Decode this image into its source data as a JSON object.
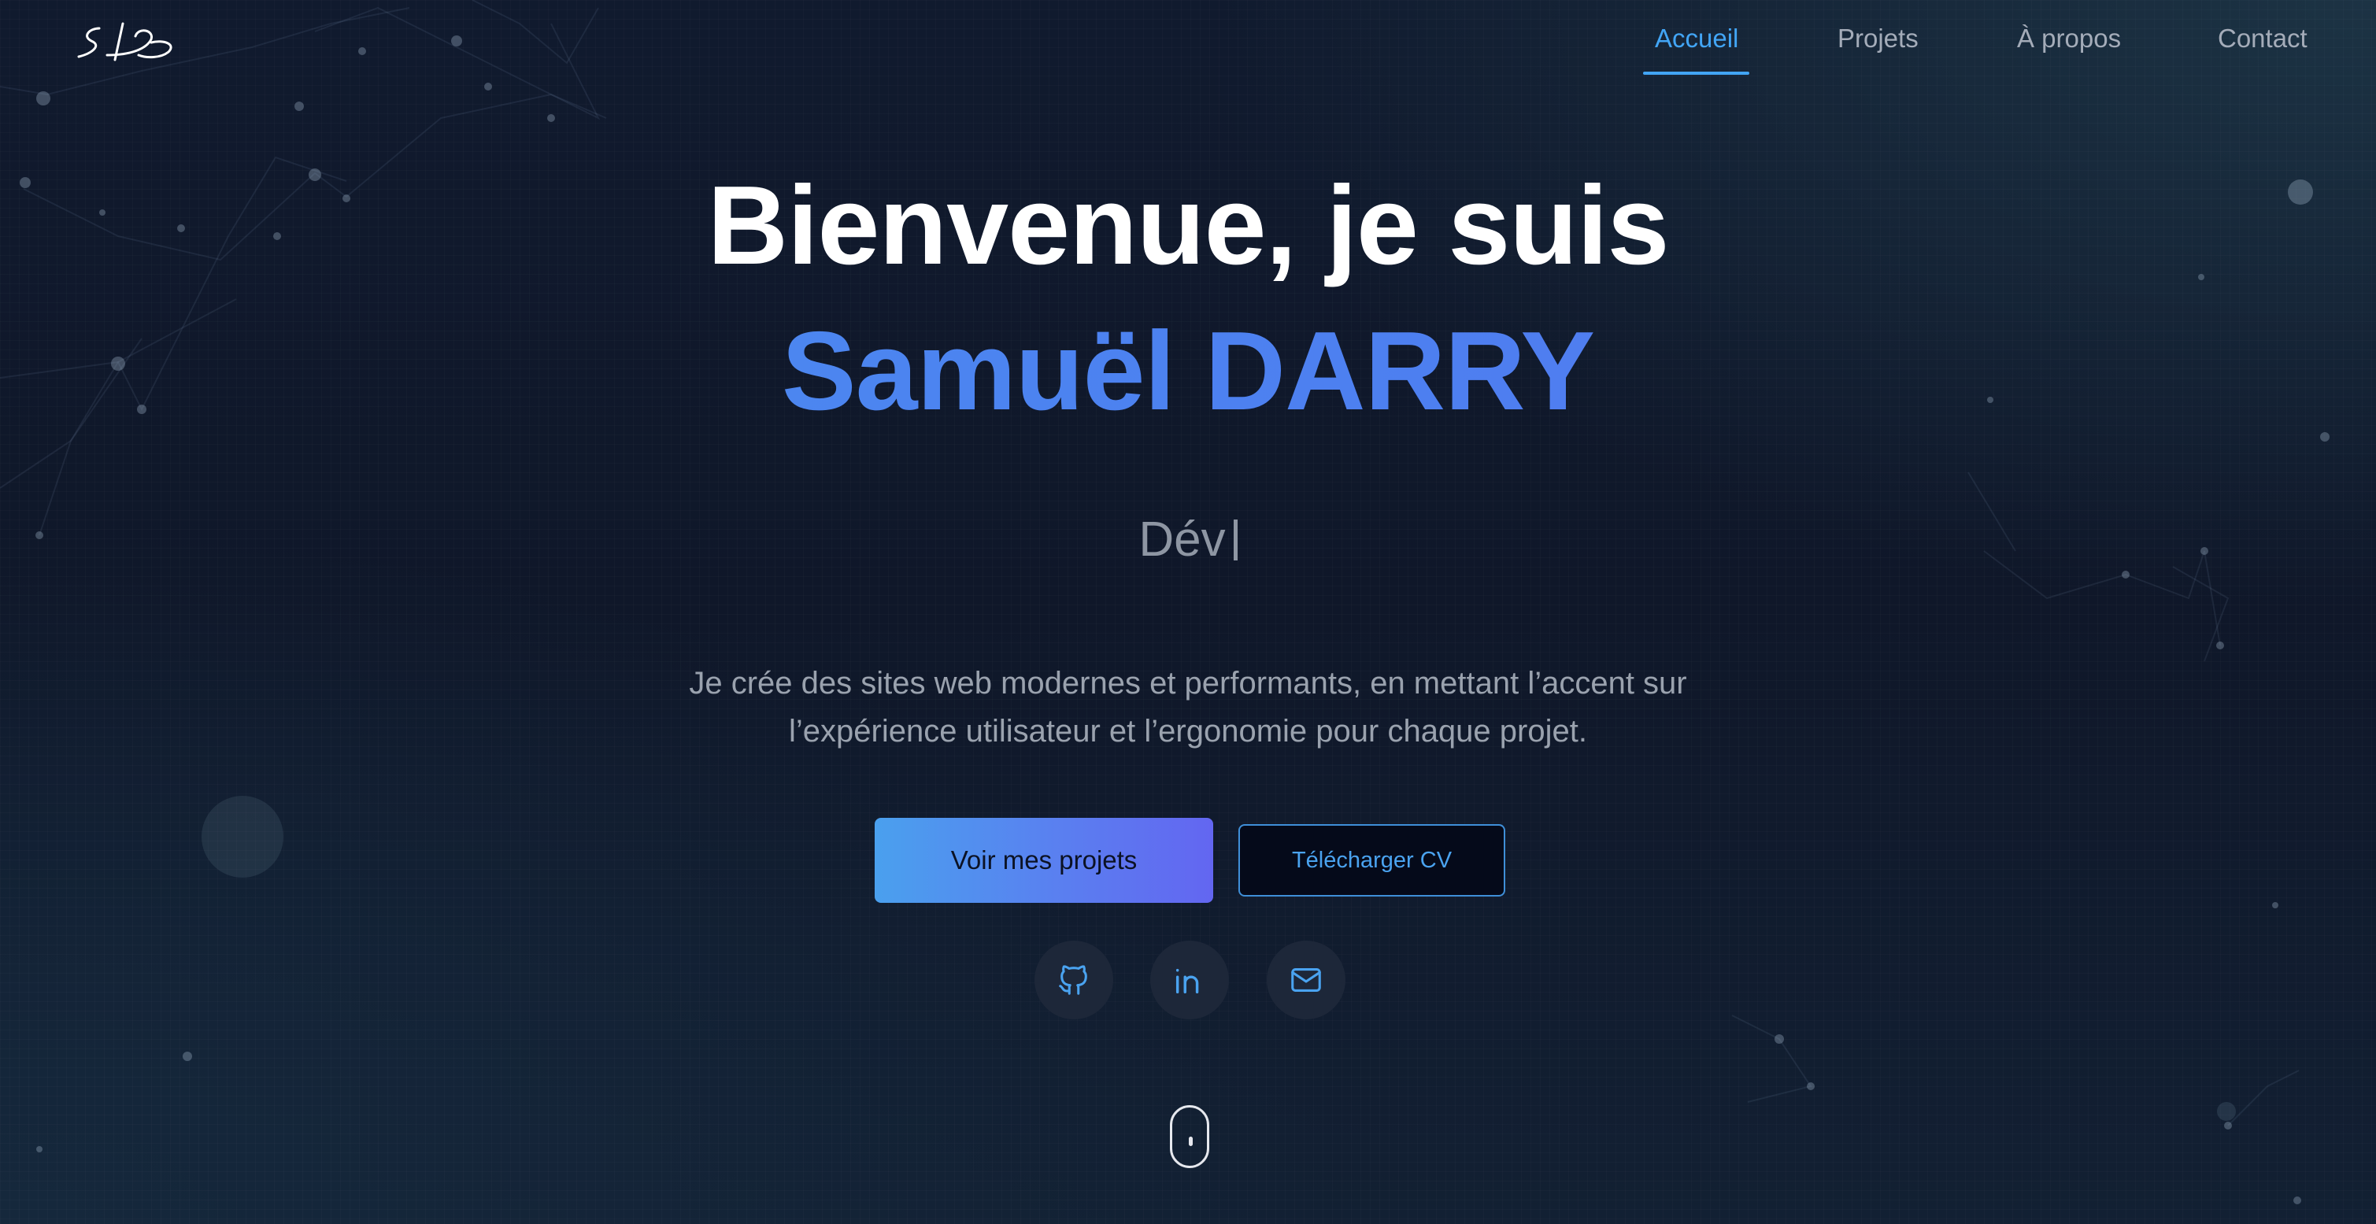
{
  "header": {
    "logo_text": "SD",
    "nav": [
      {
        "label": "Accueil",
        "active": true
      },
      {
        "label": "Projets",
        "active": false
      },
      {
        "label": "À propos",
        "active": false
      },
      {
        "label": "Contact",
        "active": false
      }
    ]
  },
  "hero": {
    "greeting": "Bienvenue, je suis",
    "name": "Samuël DARRY",
    "typed_text": "Dév",
    "description_line1": "Je crée des sites web modernes et performants, en mettant l’accent sur",
    "description_line2": "l’expérience utilisateur et l’ergonomie pour chaque projet.",
    "primary_button": "Voir mes projets",
    "secondary_button": "Télécharger CV",
    "socials": [
      {
        "icon": "github-icon"
      },
      {
        "icon": "linkedin-icon"
      },
      {
        "icon": "mail-icon"
      }
    ]
  },
  "colors": {
    "accent": "#42a5f5",
    "name_gradient_start": "#4b8ef0",
    "name_gradient_end": "#5b78f0",
    "button_gradient_end": "#6366f1",
    "background": "#0f1729"
  }
}
